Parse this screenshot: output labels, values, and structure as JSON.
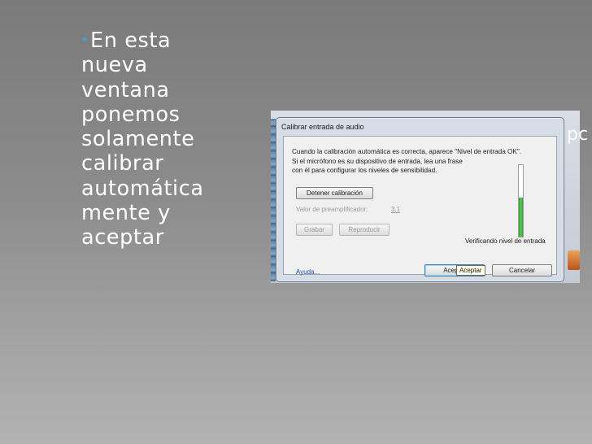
{
  "slide": {
    "lines": [
      "En esta",
      "nueva",
      "ventana",
      "ponemos",
      "solamente",
      "calibrar",
      "automática",
      "mente y",
      "aceptar"
    ],
    "bullet": "•",
    "bullet_color": "#3aa0d8"
  },
  "background": {
    "right_text": "pc"
  },
  "dialog": {
    "title": "Calibrar entrada de audio",
    "message": [
      "Cuando la calibración automática es correcta, aparece \"Nivel de entrada OK\".",
      "Si el micrófono es su dispositivo de entrada, lea una frase",
      "con él para configurar los niveles de sensibilidad."
    ],
    "stop_button": "Detener calibración",
    "preamp_label": "Valor de preamplificador:",
    "preamp_value": "3,1",
    "record_button": "Grabar",
    "play_button": "Reproducir",
    "status": "Verificando nivel de entrada",
    "level": 0.55,
    "help_link": "Ayuda...",
    "accept_button": "Aceptar",
    "cancel_button": "Cancelar",
    "tooltip": "Aceptar"
  }
}
